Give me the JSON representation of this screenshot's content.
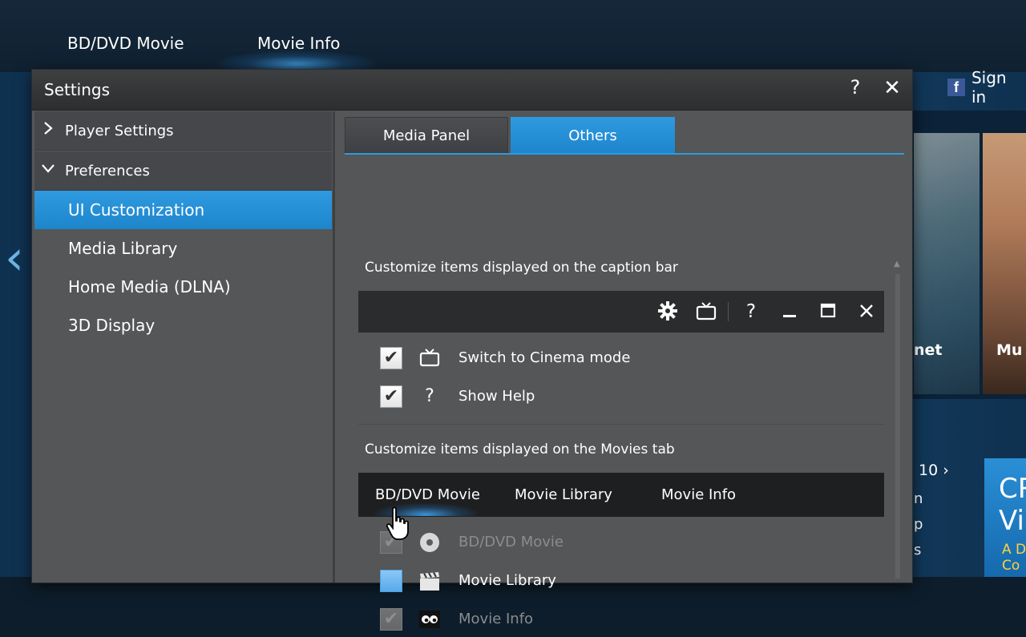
{
  "background_app": {
    "tabs": [
      "BD/DVD Movie",
      "Movie Info"
    ],
    "sign_in": "Sign in",
    "thumb_captions": [
      "net",
      "Mu"
    ],
    "page_indicator": "10 ›",
    "side_letters": [
      "n",
      "p",
      "s"
    ],
    "ad_text": "CR\nVi",
    "ad_sub": "A D\nCo"
  },
  "dialog": {
    "title": "Settings",
    "help_glyph": "?",
    "close_glyph": "✕"
  },
  "nav": {
    "sections": [
      {
        "label": "Player Settings",
        "expanded": false
      },
      {
        "label": "Preferences",
        "expanded": true
      }
    ],
    "items": [
      {
        "label": "UI Customization",
        "active": true
      },
      {
        "label": "Media Library",
        "active": false
      },
      {
        "label": "Home Media (DLNA)",
        "active": false
      },
      {
        "label": "3D Display",
        "active": false
      }
    ]
  },
  "content": {
    "tabs": [
      {
        "label": "Media Panel",
        "active": false
      },
      {
        "label": "Others",
        "active": true
      }
    ],
    "caption_section": {
      "title": "Customize items displayed on the caption bar",
      "bar_icons": [
        "gear-icon",
        "tv-icon",
        "help-icon",
        "minimize-icon",
        "maximize-icon",
        "close-icon"
      ],
      "options": [
        {
          "label": "Switch to Cinema mode",
          "icon": "tv-icon",
          "checked": true
        },
        {
          "label": "Show Help",
          "icon": "help-icon",
          "checked": true
        }
      ]
    },
    "movies_section": {
      "title": "Customize items displayed on the Movies tab",
      "bar_tabs": [
        "BD/DVD Movie",
        "Movie Library",
        "Movie Info"
      ],
      "options": [
        {
          "label": "BD/DVD Movie",
          "icon": "disc-icon",
          "checked": true,
          "disabled": true
        },
        {
          "label": "Movie Library",
          "icon": "clapperboard-icon",
          "checked": false,
          "disabled": false
        },
        {
          "label": "Movie Info",
          "icon": "eyes-icon",
          "checked": true,
          "disabled": true
        }
      ]
    }
  }
}
